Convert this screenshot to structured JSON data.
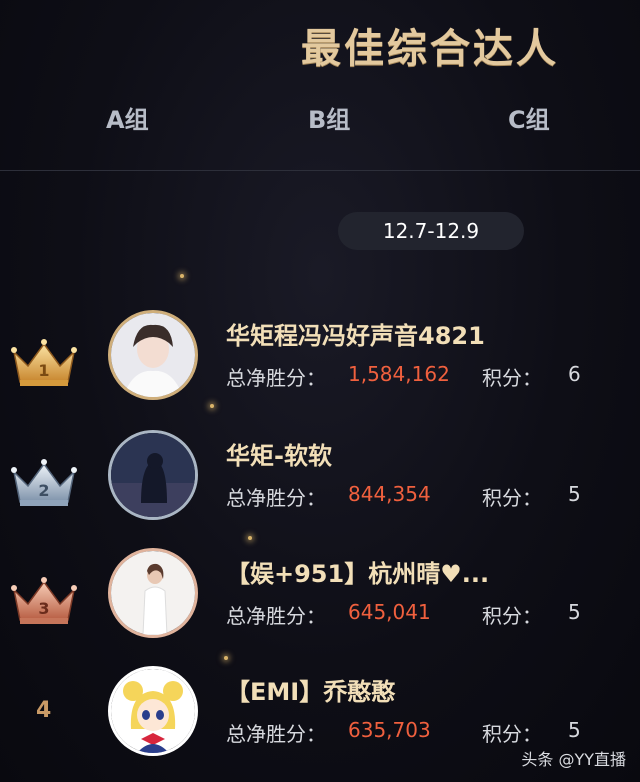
{
  "title": "最佳综合达人",
  "tabs": [
    {
      "label": "A组"
    },
    {
      "label": "B组"
    },
    {
      "label": "C组"
    }
  ],
  "date_range": "12.7-12.9",
  "stat_labels": {
    "win": "总净胜分：",
    "score": "积分："
  },
  "entries": [
    {
      "rank": "1",
      "name": "华矩程冯冯好声音4821",
      "win": "1,584,162",
      "score": "6",
      "badge": "gold-crown-icon"
    },
    {
      "rank": "2",
      "name": "华矩-软软",
      "win": "844,354",
      "score": "5",
      "badge": "silver-crown-icon"
    },
    {
      "rank": "3",
      "name": "【娱+951】杭州晴♥...",
      "win": "645,041",
      "score": "5",
      "badge": "bronze-crown-icon"
    },
    {
      "rank": "4",
      "name": "【EMI】乔憨憨",
      "win": "635,703",
      "score": "5",
      "badge": "rank-number"
    }
  ],
  "watermark": "头条 @YY直播",
  "colors": {
    "title": "#e3c99e",
    "name": "#f2dfb8",
    "win_value": "#f0603e",
    "gold": "#e7b95a",
    "silver": "#9fb2c8",
    "bronze": "#d88a6a"
  }
}
